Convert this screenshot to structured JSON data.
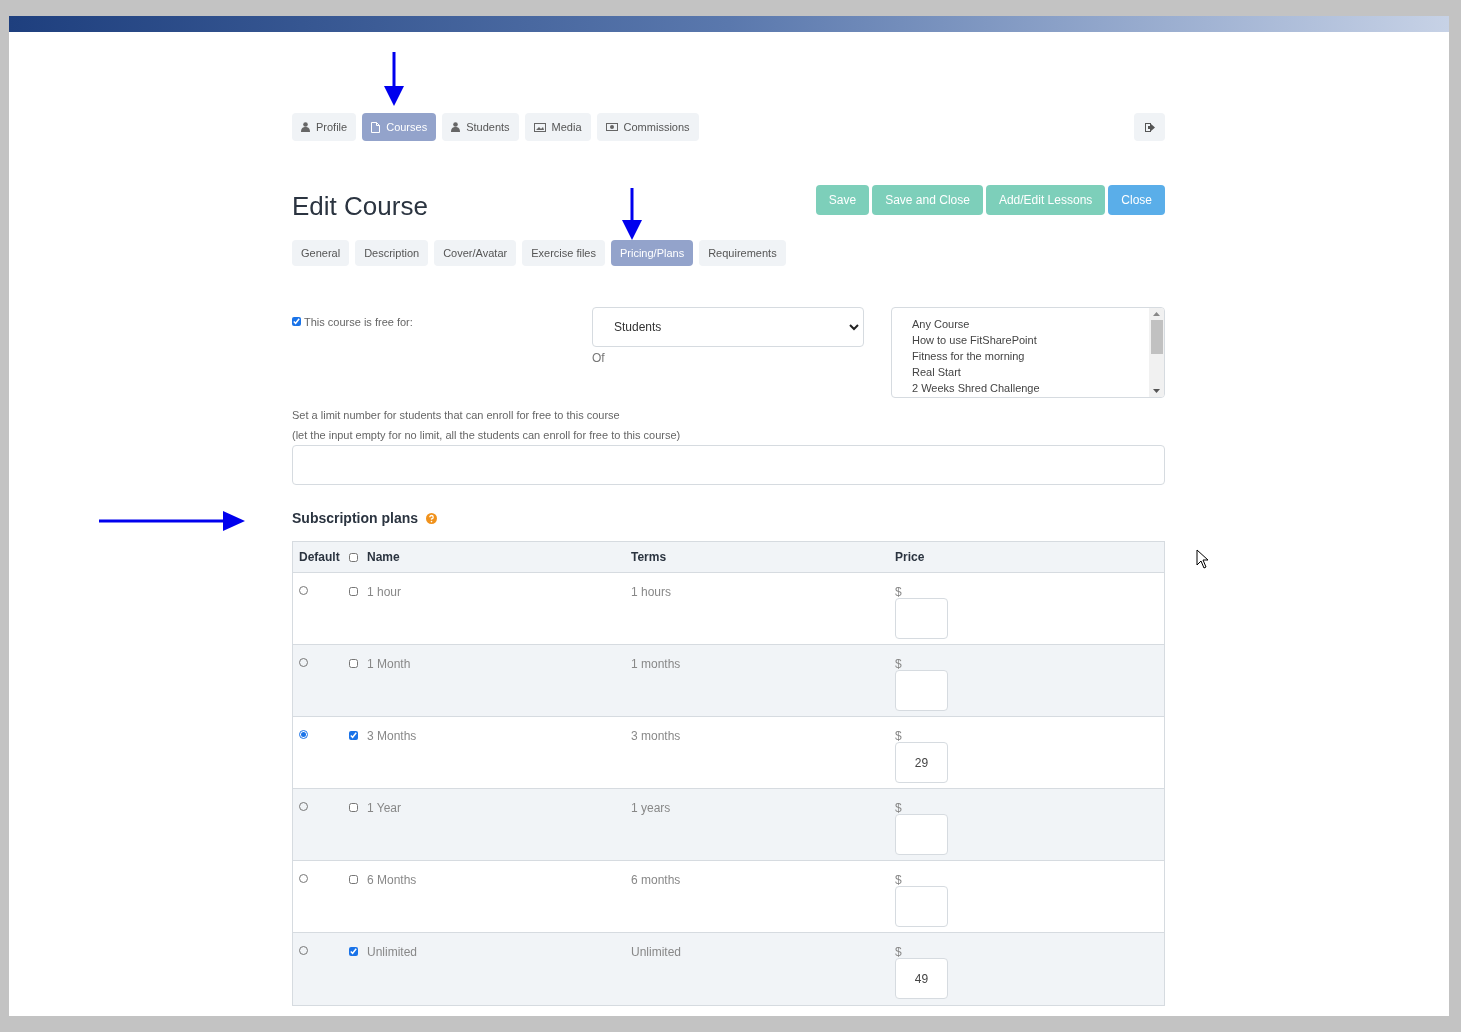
{
  "nav_tabs": [
    {
      "label": "Profile",
      "kind": "user",
      "selected": false
    },
    {
      "label": "Courses",
      "kind": "file",
      "selected": true
    },
    {
      "label": "Students",
      "kind": "user",
      "selected": false
    },
    {
      "label": "Media",
      "kind": "image",
      "selected": false
    },
    {
      "label": "Commissions",
      "kind": "money",
      "selected": false
    }
  ],
  "title": "Edit Course",
  "actions": [
    {
      "label": "Save",
      "kind": "success"
    },
    {
      "label": "Save and Close",
      "kind": "success"
    },
    {
      "label": "Add/Edit Lessons",
      "kind": "success"
    },
    {
      "label": "Close",
      "kind": "info"
    }
  ],
  "sub_tabs": [
    {
      "label": "General",
      "selected": false
    },
    {
      "label": "Description",
      "selected": false
    },
    {
      "label": "Cover/Avatar",
      "selected": false
    },
    {
      "label": "Exercise files",
      "selected": false
    },
    {
      "label": "Pricing/Plans",
      "selected": true
    },
    {
      "label": "Requirements",
      "selected": false
    }
  ],
  "free_for": {
    "checked": true,
    "label": "This course is free for:",
    "select_value": "Students",
    "of_label": "Of",
    "courses": [
      "Any Course",
      "How to use FitSharePoint",
      "Fitness for the morning",
      "Real Start",
      "2 Weeks Shred Challenge"
    ]
  },
  "limit": {
    "label": "Set a limit number for students that can enroll for free to this course",
    "hint": "(let the input empty for no limit, all the students can enroll for free to this course)"
  },
  "plans": {
    "title": "Subscription plans",
    "columns": [
      "Default",
      "Name",
      "Terms",
      "Price"
    ],
    "header_checked": false,
    "rows": [
      {
        "selected": false,
        "checked": false,
        "name": "1 hour",
        "terms": "1 hours",
        "currency": "$"
      },
      {
        "selected": false,
        "checked": false,
        "name": "1 Month",
        "terms": "1 months",
        "currency": "$"
      },
      {
        "selected": true,
        "checked": true,
        "name": "3 Months",
        "terms": "3 months",
        "currency": "$",
        "price": "29"
      },
      {
        "selected": false,
        "checked": false,
        "name": "1 Year",
        "terms": "1 years",
        "currency": "$"
      },
      {
        "selected": false,
        "checked": false,
        "name": "6 Months",
        "terms": "6 months",
        "currency": "$"
      },
      {
        "selected": false,
        "checked": true,
        "name": "Unlimited",
        "terms": "Unlimited",
        "currency": "$",
        "price": "49"
      }
    ]
  }
}
